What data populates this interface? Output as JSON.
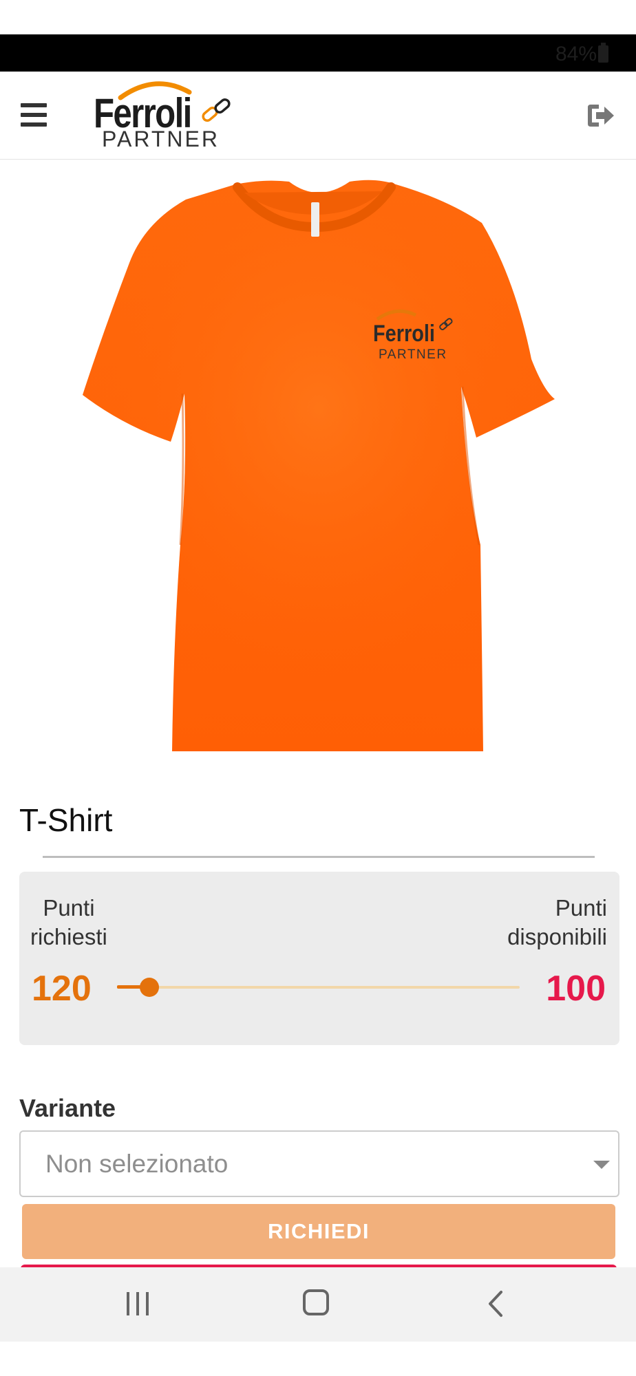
{
  "status_bar": {
    "battery_text": "84%",
    "icons": [
      "battery-icon"
    ]
  },
  "header": {
    "logo_brand": "Ferroli",
    "logo_sub": "PARTNER",
    "menu_icon": "hamburger-menu-icon",
    "logout_icon": "logout-icon"
  },
  "product": {
    "image_alt_icon": "t-shirt-image",
    "image_logo_brand": "Ferroli",
    "image_logo_sub": "PARTNER",
    "title": "T-Shirt"
  },
  "points": {
    "required_label_line1": "Punti",
    "required_label_line2": "richiesti",
    "available_label_line1": "Punti",
    "available_label_line2": "disponibili",
    "required_value": "120",
    "available_value": "100",
    "progress_fraction": 0.08
  },
  "variant": {
    "label": "Variante",
    "selected": "Non selezionato"
  },
  "actions": {
    "request_label": "RICHIEDI"
  },
  "nav": {
    "icons": [
      "recent-apps-icon",
      "home-icon",
      "back-icon"
    ]
  },
  "colors": {
    "accent_orange": "#e4720c",
    "points_available": "#e6194b",
    "button_bg": "#f2b07c",
    "shirt_orange": "#ff6a0d"
  }
}
